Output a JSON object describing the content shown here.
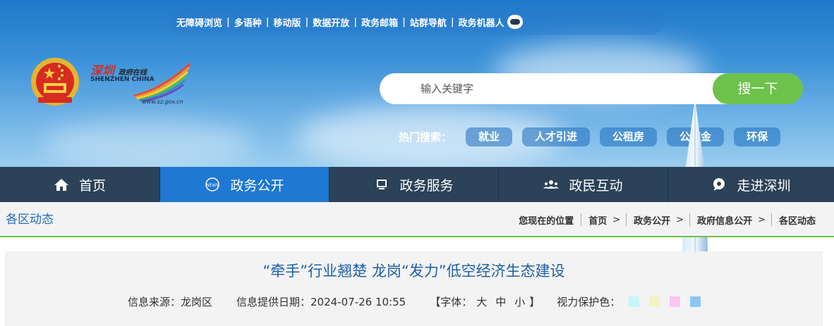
{
  "top_links": [
    "无障碍浏览",
    "多语种",
    "移动版",
    "数据开放",
    "政务邮箱",
    "站群导航",
    "政务机器人"
  ],
  "logo": {
    "cn_text": "深圳",
    "cn_sub": "政府在线",
    "en_text": "SHENZHEN CHINA",
    "url": "www.sz.gov.cn"
  },
  "search": {
    "placeholder": "输入关键字",
    "button_label": "搜一下"
  },
  "hot_search": {
    "label": "热门搜索：",
    "tags": [
      "就业",
      "人才引进",
      "公租房",
      "公积金",
      "环保"
    ]
  },
  "nav": {
    "items": [
      {
        "label": "首页",
        "icon": "home-icon"
      },
      {
        "label": "政务公开",
        "icon": "news-icon",
        "active": true
      },
      {
        "label": "政务服务",
        "icon": "monitor-icon"
      },
      {
        "label": "政民互动",
        "icon": "people-icon"
      },
      {
        "label": "走进深圳",
        "icon": "chat-bubble-icon"
      }
    ]
  },
  "breadcrumb": {
    "section_title": "各区动态",
    "location_label": "您现在的位置",
    "items": [
      "首页",
      "政务公开",
      "政府信息公开",
      "各区动态"
    ]
  },
  "article": {
    "title": "“牵手”行业翘楚 龙岗“发力”低空经济生态建设",
    "source_label": "信息来源：龙岗区",
    "date_label": "信息提供日期：2024-07-26 10:55",
    "font_size_open": "【字体：",
    "font_sizes": [
      "大",
      "中",
      "小"
    ],
    "font_size_close": "】",
    "eye_care_label": "视力保护色：",
    "eye_care_colors": [
      "#c6f6f9",
      "#f3f3c4",
      "#f9c6f3",
      "#8ec6f2"
    ]
  },
  "colors": {
    "nav_bg": "#2b4258",
    "nav_active": "#1f78d1",
    "accent_green": "#6cc24a",
    "title_blue": "#1f5fa8"
  }
}
